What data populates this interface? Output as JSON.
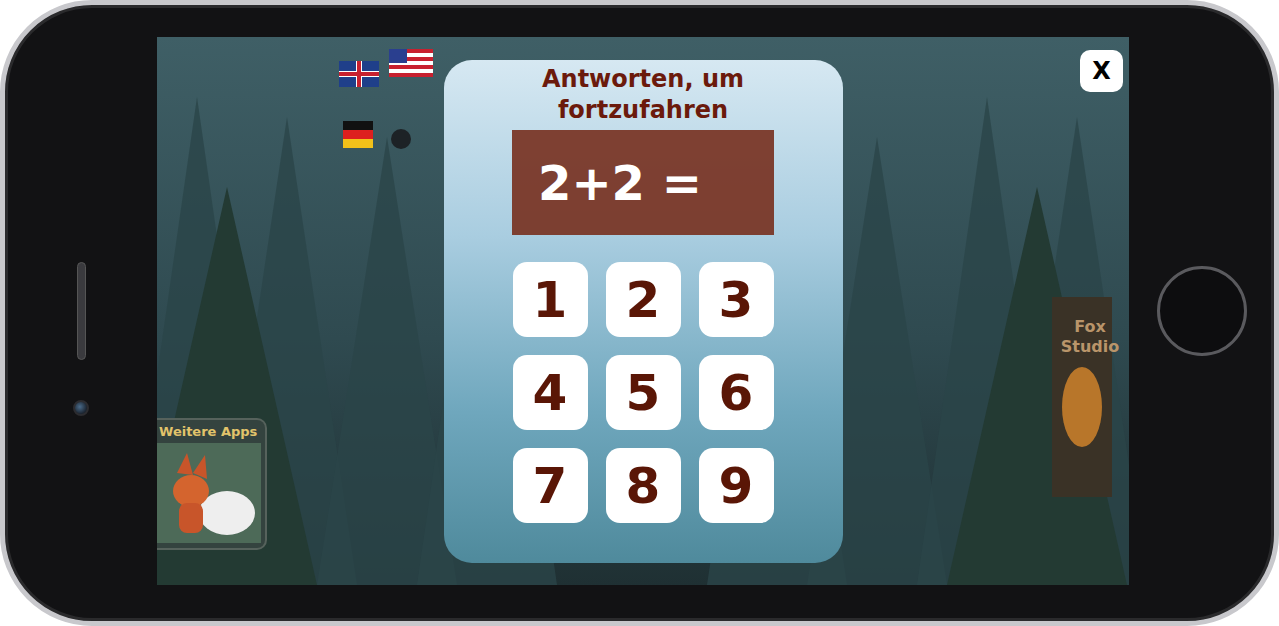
{
  "app": {
    "close_button": "X",
    "more_apps": {
      "label": "Weitere Apps"
    },
    "sign": {
      "text": "Fox Studio"
    }
  },
  "dialog": {
    "title": "Antworten, um fortzufahren",
    "question": "2+2 =",
    "keys": [
      "1",
      "2",
      "3",
      "4",
      "5",
      "6",
      "7",
      "8",
      "9"
    ]
  }
}
